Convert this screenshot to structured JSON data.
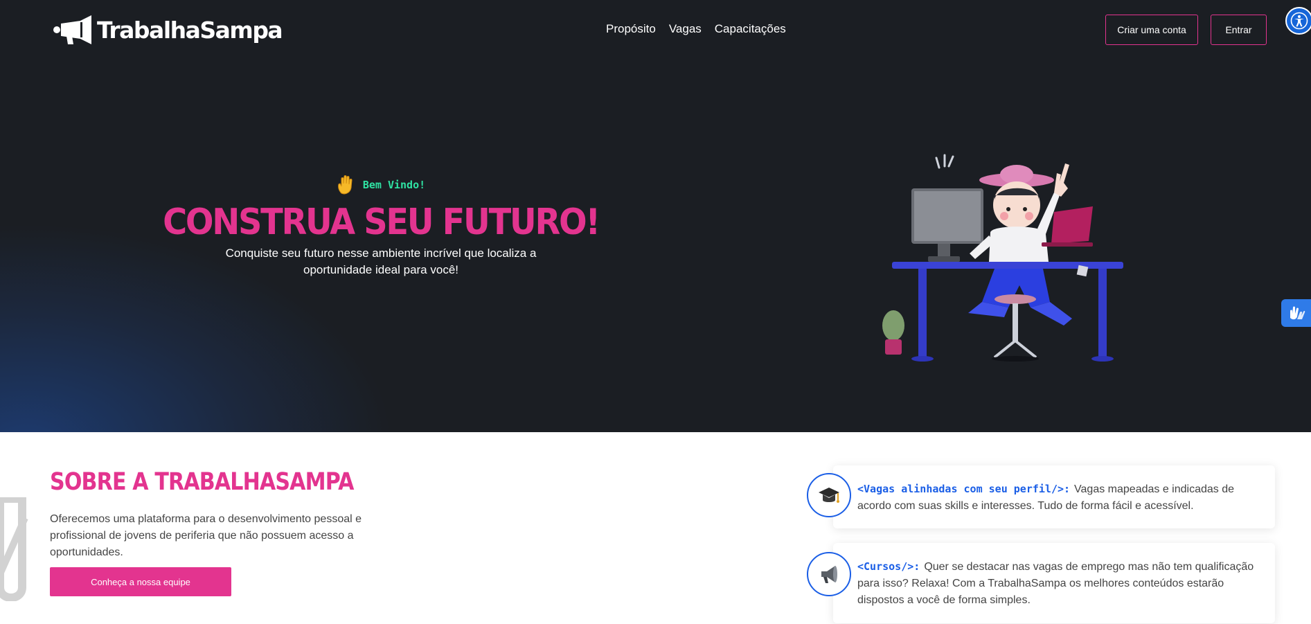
{
  "brand": {
    "name": "TrabalhaSampa"
  },
  "nav": {
    "items": [
      "Propósito",
      "Vagas",
      "Capacitações"
    ]
  },
  "header": {
    "create_account": "Criar uma conta",
    "login": "Entrar"
  },
  "hero": {
    "welcome": "Bem Vindo!",
    "title": "CONSTRUA SEU FUTURO!",
    "subtitle": "Conquiste seu futuro nesse ambiente incrível que localiza a oportunidade ideal para você!"
  },
  "about": {
    "title": "SOBRE A TRABALHASAMPA",
    "text": "Oferecemos uma plataforma para o desenvolvimento pessoal e profissional de jovens de periferia que não possuem acesso a oportunidades.",
    "button": "Conheça a nossa equipe"
  },
  "features": [
    {
      "label": "<Vagas alinhadas com seu perfil/>:",
      "text": "Vagas mapeadas e indicadas de acordo com suas skills e interesses. Tudo de forma fácil e acessível.",
      "icon": "graduation-cap-icon"
    },
    {
      "label": "<Cursos/>:",
      "text": "Quer se destacar nas vagas de emprego mas não tem qualificação para isso? Relaxa! Com a TrabalhaSampa os melhores conteúdos estarão dispostos a você de forma simples.",
      "icon": "megaphone-icon"
    }
  ],
  "colors": {
    "accent": "#e3348f",
    "dark_bg": "#1b1e23",
    "link_blue": "#1a5ee6",
    "welcome_green": "#2fe3a3"
  }
}
